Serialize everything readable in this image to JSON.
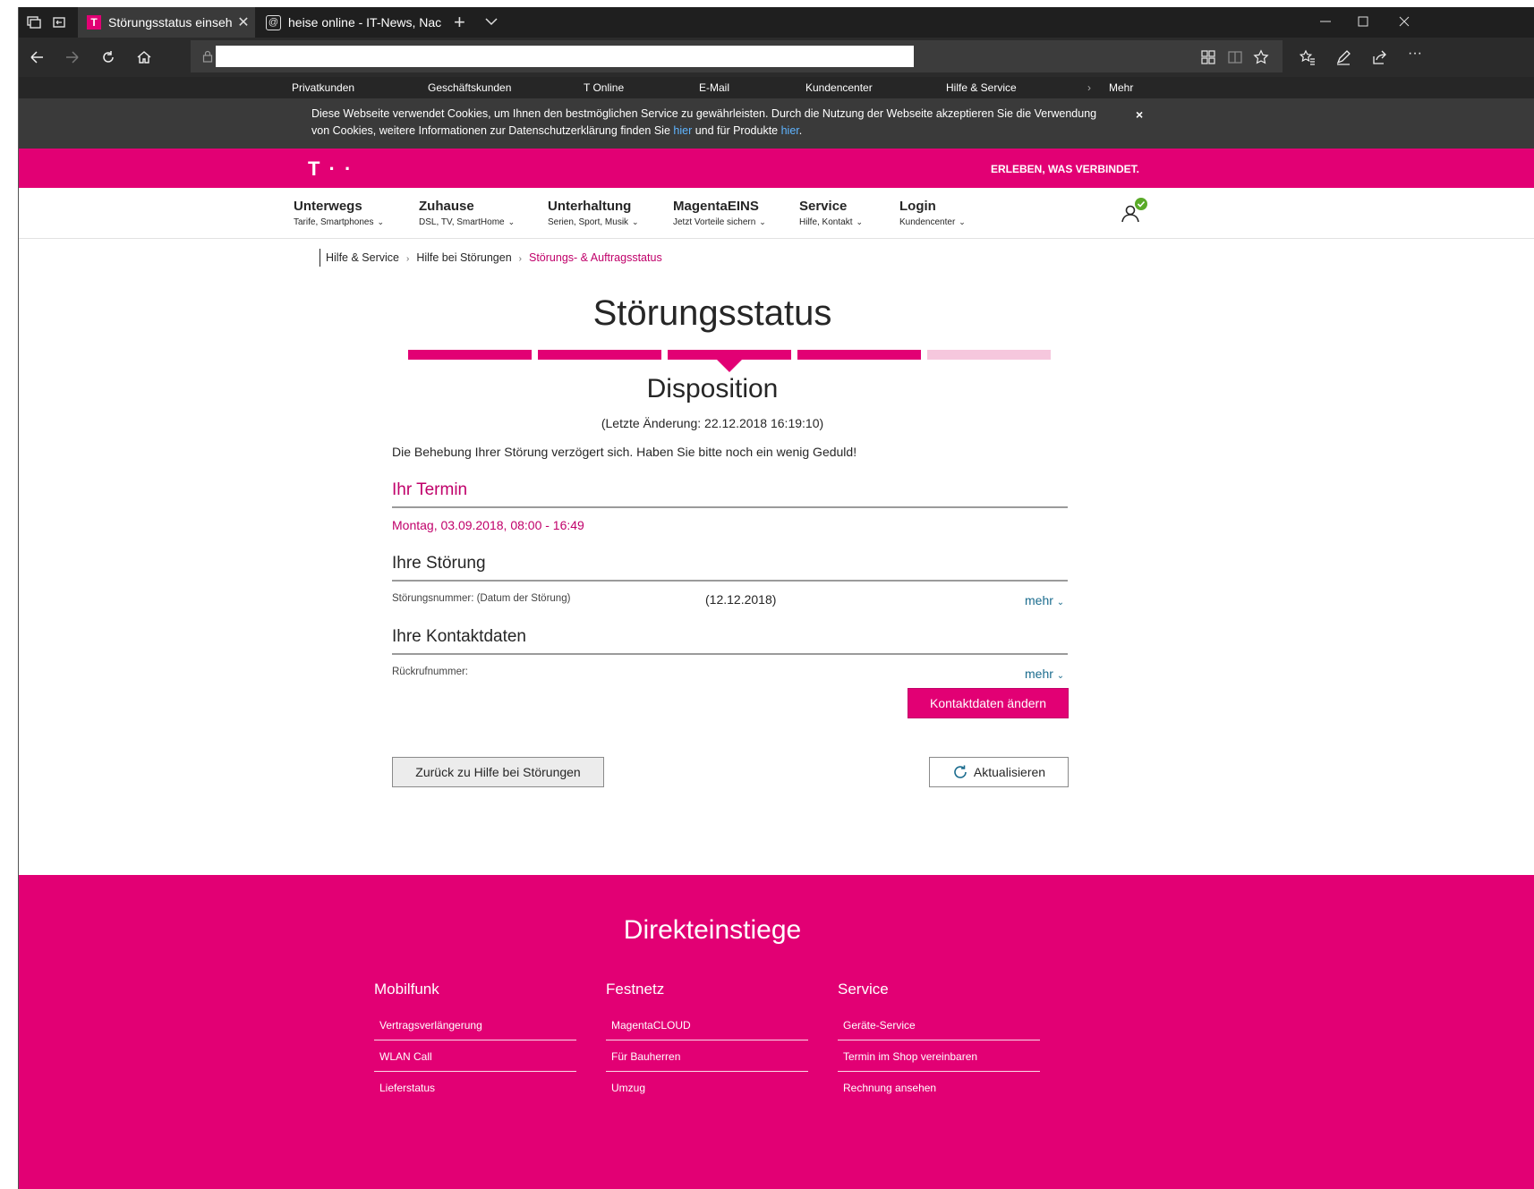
{
  "browser": {
    "tabs": [
      {
        "title": "Störungsstatus einsehe"
      },
      {
        "title": "heise online - IT-News, Nac"
      }
    ]
  },
  "meta_nav": {
    "items": [
      "Privatkunden",
      "Geschäftskunden",
      "T Online",
      "E-Mail",
      "Kundencenter",
      "Hilfe & Service",
      "Mehr"
    ]
  },
  "cookie": {
    "text_1": "Diese Webseite verwendet Cookies, um Ihnen den bestmöglichen Service zu gewährleisten. Durch die Nutzung der Webseite akzeptieren Sie die Verwendung von Cookies, weitere Informationen zur Datenschutzerklärung finden Sie ",
    "link_1": "hier",
    "text_2": " und für Produkte ",
    "link_2": "hier",
    "text_3": ".",
    "close": "×"
  },
  "brand": {
    "logo": "T · ·",
    "slogan": "ERLEBEN, WAS VERBINDET."
  },
  "nav": [
    {
      "title": "Unterwegs",
      "sub": "Tarife, Smartphones"
    },
    {
      "title": "Zuhause",
      "sub": "DSL, TV, SmartHome"
    },
    {
      "title": "Unterhaltung",
      "sub": "Serien, Sport, Musik"
    },
    {
      "title": "MagentaEINS",
      "sub": "Jetzt Vorteile sichern"
    },
    {
      "title": "Service",
      "sub": "Hilfe, Kontakt"
    },
    {
      "title": "Login",
      "sub": "Kundencenter"
    }
  ],
  "breadcrumb": [
    "Hilfe & Service",
    "Hilfe bei Störungen",
    "Störungs- & Auftragsstatus"
  ],
  "status": {
    "title": "Störungsstatus",
    "steps_total": 5,
    "steps_done": 4,
    "current_step": 3,
    "phase": "Disposition",
    "last_change": "(Letzte Änderung: 22.12.2018 16:19:10)",
    "message": "Die Behebung Ihrer Störung verzögert sich. Haben Sie bitte noch ein wenig Geduld!"
  },
  "termin": {
    "heading": "Ihr Termin",
    "value": "Montag, 03.09.2018, 08:00 - 16:49"
  },
  "stoerung": {
    "heading": "Ihre Störung",
    "label": "Störungsnummer: (Datum der Störung)",
    "value": "(12.12.2018)",
    "more": "mehr"
  },
  "kontakt": {
    "heading": "Ihre Kontaktdaten",
    "label": "Rückrufnummer:",
    "more": "mehr",
    "edit_button": "Kontaktdaten ändern"
  },
  "actions": {
    "back": "Zurück zu Hilfe bei Störungen",
    "refresh": "Aktualisieren"
  },
  "footer": {
    "title": "Direkteinstiege",
    "columns": [
      {
        "heading": "Mobilfunk",
        "links": [
          "Vertragsverlängerung",
          "WLAN Call",
          "Lieferstatus"
        ]
      },
      {
        "heading": "Festnetz",
        "links": [
          "MagentaCLOUD",
          "Für Bauherren",
          "Umzug"
        ]
      },
      {
        "heading": "Service",
        "links": [
          "Geräte-Service",
          "Termin im Shop vereinbaren",
          "Rechnung ansehen"
        ]
      }
    ]
  },
  "colors": {
    "magenta": "#e20074",
    "progress_inactive": "#f6c7dd",
    "link_blue": "#1b6c8e"
  }
}
